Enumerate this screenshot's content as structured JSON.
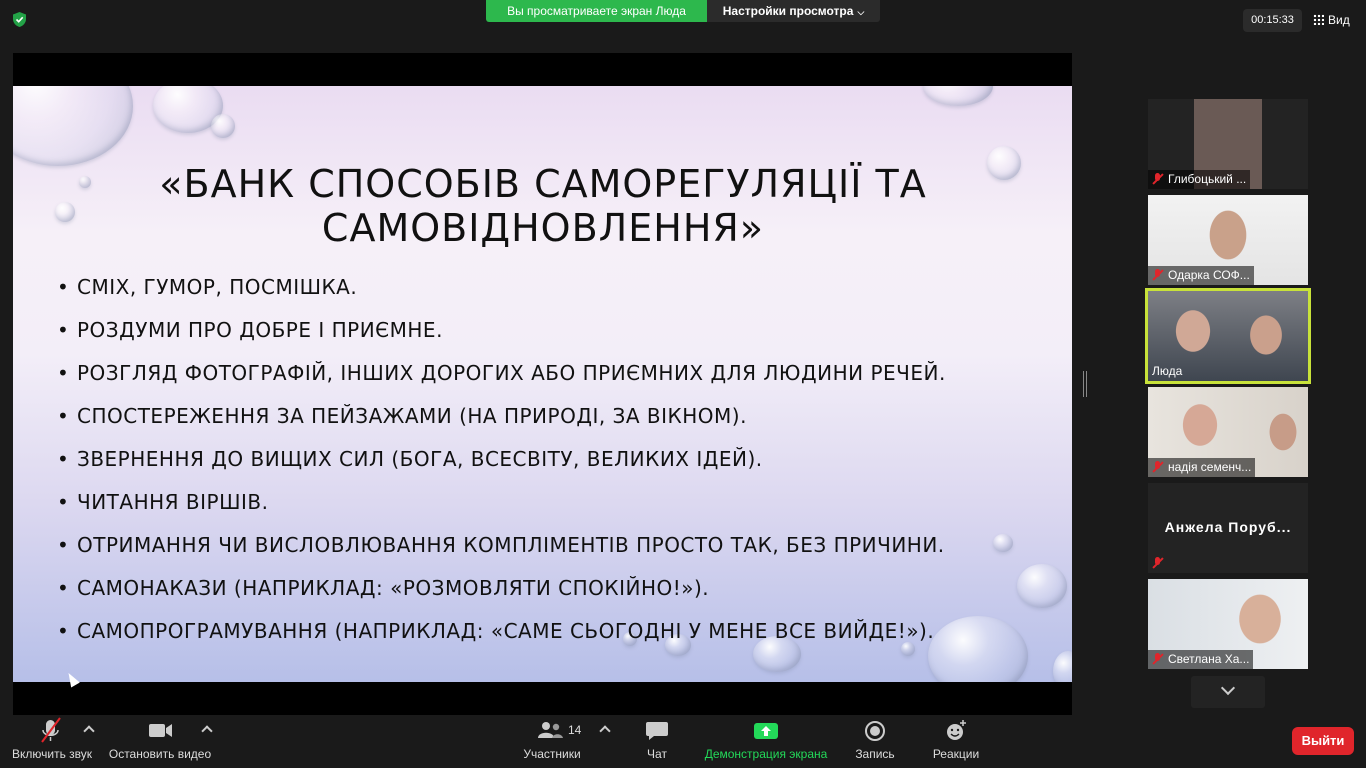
{
  "top_bar": {
    "viewing_banner": "Вы просматриваете экран Люда",
    "view_settings_label": "Настройки просмотра",
    "timer": "00:15:33",
    "view_label": "Вид"
  },
  "slide": {
    "title_line1": "«БАНК СПОСОБІВ САМОРЕГУЛЯЦІЇ ТА",
    "title_line2": "САМОВІДНОВЛЕННЯ»",
    "bullet": "•",
    "items": [
      "СМІХ, ГУМОР, ПОСМІШКА.",
      "РОЗДУМИ ПРО ДОБРЕ І ПРИЄМНЕ.",
      "РОЗГЛЯД ФОТОГРАФІЙ, ІНШИХ ДОРОГИХ АБО ПРИЄМНИХ ДЛЯ ЛЮДИНИ РЕЧЕЙ.",
      "СПОСТЕРЕЖЕННЯ ЗА ПЕЙЗАЖАМИ (НА ПРИРОДІ, ЗА ВІКНОМ).",
      "ЗВЕРНЕННЯ ДО ВИЩИХ СИЛ (БОГА, ВСЕСВІТУ, ВЕЛИКИХ ІДЕЙ).",
      "ЧИТАННЯ ВІРШІВ.",
      "ОТРИМАННЯ ЧИ ВИСЛОВЛЮВАННЯ КОМПЛІМЕНТІВ ПРОСТО ТАК, БЕЗ ПРИЧИНИ.",
      "САМОНАКАЗИ (НАПРИКЛАД: «РОЗМОВЛЯТИ СПОКІЙНО!»).",
      "САМОПРОГРАМУВАННЯ (НАПРИКЛАД: «САМЕ СЬОГОДНІ У МЕНЕ ВСЕ ВИЙДЕ!»)."
    ]
  },
  "participants": [
    {
      "name": "Глибоцький ...",
      "muted": true
    },
    {
      "name": "Одарка СОФ...",
      "muted": true
    },
    {
      "name": "Люда",
      "muted": false,
      "active": true
    },
    {
      "name": "надія семенч...",
      "muted": true
    },
    {
      "name": "Анжела Поруб...",
      "muted": true,
      "video": false
    },
    {
      "name": "Светлана Ха...",
      "muted": true
    }
  ],
  "toolbar": {
    "unmute_label": "Включить звук",
    "stop_video_label": "Остановить видео",
    "participants_label": "Участники",
    "participants_count": "14",
    "chat_label": "Чат",
    "share_label": "Демонстрация экрана",
    "record_label": "Запись",
    "reactions_label": "Реакции",
    "leave_label": "Выйти"
  },
  "colors": {
    "banner_green": "#2db84d",
    "share_green": "#23d959",
    "leave_red": "#e0252b",
    "active_speaker": "#c8e23a"
  }
}
